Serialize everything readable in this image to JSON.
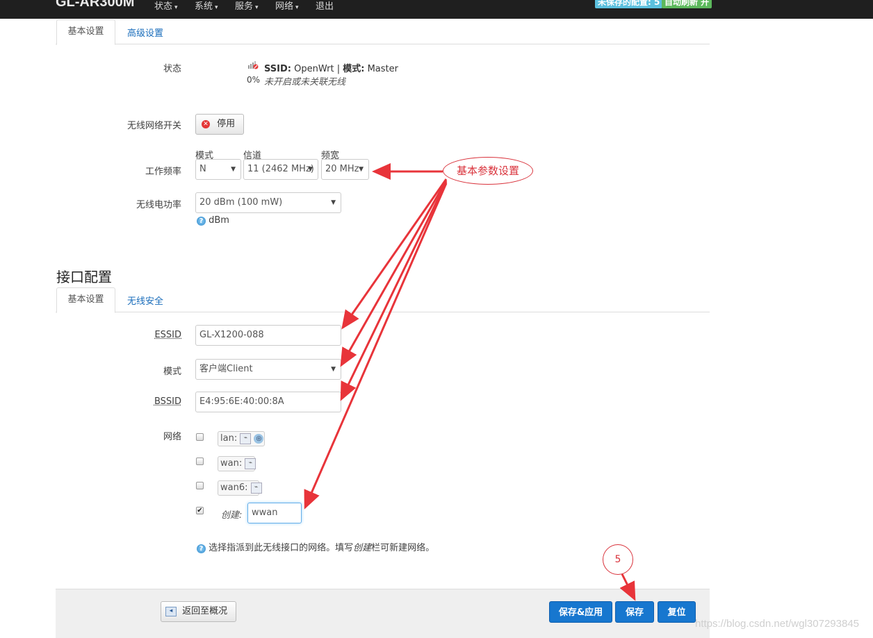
{
  "header": {
    "brand": "GL-AR300M",
    "nav": [
      {
        "label": "状态"
      },
      {
        "label": "系统"
      },
      {
        "label": "服务"
      },
      {
        "label": "网络"
      },
      {
        "label": "退出"
      }
    ],
    "unsaved_badge": "未保存的配置: 5",
    "autorefresh_badge": "自动刷新 开",
    "colors": {
      "unsaved": "#5bc0de",
      "autorefresh": "#5cb85c"
    }
  },
  "device_tabs": {
    "basic": "基本设置",
    "advanced": "高级设置"
  },
  "device": {
    "status_label": "状态",
    "ssid_key": "SSID:",
    "ssid_value": "OpenWrt",
    "separator": "|",
    "mode_key": "模式:",
    "mode_value": "Master",
    "signal_percent": "0%",
    "status_note": "未开启或未关联无线",
    "wifi_switch_label": "无线网络开关",
    "disable_button": "停用",
    "freq_label": "工作频率",
    "mode_col": "模式",
    "channel_col": "信道",
    "width_col": "频宽",
    "mode_value_sel": "N",
    "channel_value": "11 (2462 MHz)",
    "width_value": "20 MHz",
    "power_label": "无线电功率",
    "power_value": "20 dBm (100 mW)",
    "power_hint": "dBm"
  },
  "iface": {
    "section_title": "接口配置",
    "tabs": {
      "basic": "基本设置",
      "security": "无线安全"
    },
    "essid_label": "ESSID",
    "essid_value": "GL-X1200-088",
    "mode_label": "模式",
    "mode_value": "客户端Client",
    "bssid_label": "BSSID",
    "bssid_value": "E4:95:6E:40:00:8A",
    "network_label": "网络",
    "networks": [
      {
        "name": "lan:",
        "checked": false
      },
      {
        "name": "wan:",
        "checked": false
      },
      {
        "name": "wan6:",
        "checked": false
      }
    ],
    "create_label": "创建:",
    "create_value": "wwan",
    "create_checked": true,
    "help_text_1": "选择指派到此无线接口的网络。填写",
    "help_text_em": "创建",
    "help_text_2": "栏可新建网络。"
  },
  "footer": {
    "back_button": "返回至概况",
    "save_apply": "保存&应用",
    "save": "保存",
    "reset": "复位"
  },
  "annotations": {
    "basic_params": "基本参数设置",
    "step": "5",
    "color": "#e8343a"
  },
  "watermark": "https://blog.csdn.net/wgl307293845"
}
